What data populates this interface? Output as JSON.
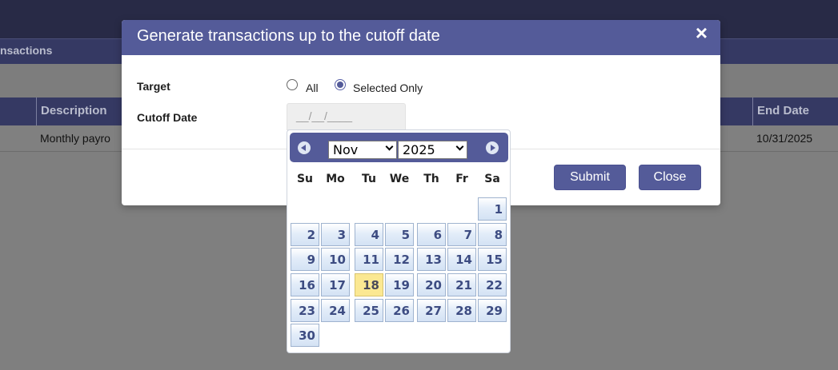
{
  "background": {
    "subnav_label": "nsactions",
    "columns": {
      "description": "Description",
      "end_date": "End Date"
    },
    "row": {
      "description": "Monthly payro",
      "end_date": "10/31/2025"
    }
  },
  "modal": {
    "title": "Generate transactions up to the cutoff date",
    "close_icon": "×",
    "target_label": "Target",
    "radio_all": "All",
    "radio_selected": "Selected Only",
    "selected_option": "Selected Only",
    "cutoff_label": "Cutoff Date",
    "cutoff_placeholder": "__/__/____",
    "submit_label": "Submit",
    "close_label": "Close"
  },
  "datepicker": {
    "month": "Nov",
    "year": "2025",
    "weekdays": [
      "Su",
      "Mo",
      "Tu",
      "We",
      "Th",
      "Fr",
      "Sa"
    ],
    "days": [
      "1",
      "2",
      "3",
      "4",
      "5",
      "6",
      "7",
      "8",
      "9",
      "10",
      "11",
      "12",
      "13",
      "14",
      "15",
      "16",
      "17",
      "18",
      "19",
      "20",
      "21",
      "22",
      "23",
      "24",
      "25",
      "26",
      "27",
      "28",
      "29",
      "30"
    ],
    "today": "18"
  },
  "colors": {
    "accent": "#545b99",
    "today_highlight": "#fbe892",
    "day_text": "#3d4c82"
  }
}
